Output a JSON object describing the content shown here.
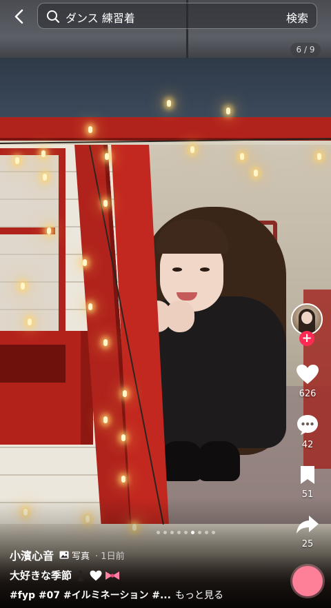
{
  "header": {
    "search_query": "ダンス 練習着",
    "search_button": "検索",
    "page_counter": "6 / 9"
  },
  "actions": {
    "likes": "626",
    "comments": "42",
    "saves": "51",
    "shares": "25"
  },
  "post": {
    "author": "小濱心音",
    "type_label": "写真",
    "time": "· 1日前",
    "caption": "大好きな季節",
    "hashtags": "#fyp #07 #イルミネーション #...",
    "more_label": "もっと見る"
  },
  "carousel": {
    "count": 9,
    "active_index": 6
  },
  "colors": {
    "accent": "#fe2c55",
    "fab": "#fe7f98"
  }
}
